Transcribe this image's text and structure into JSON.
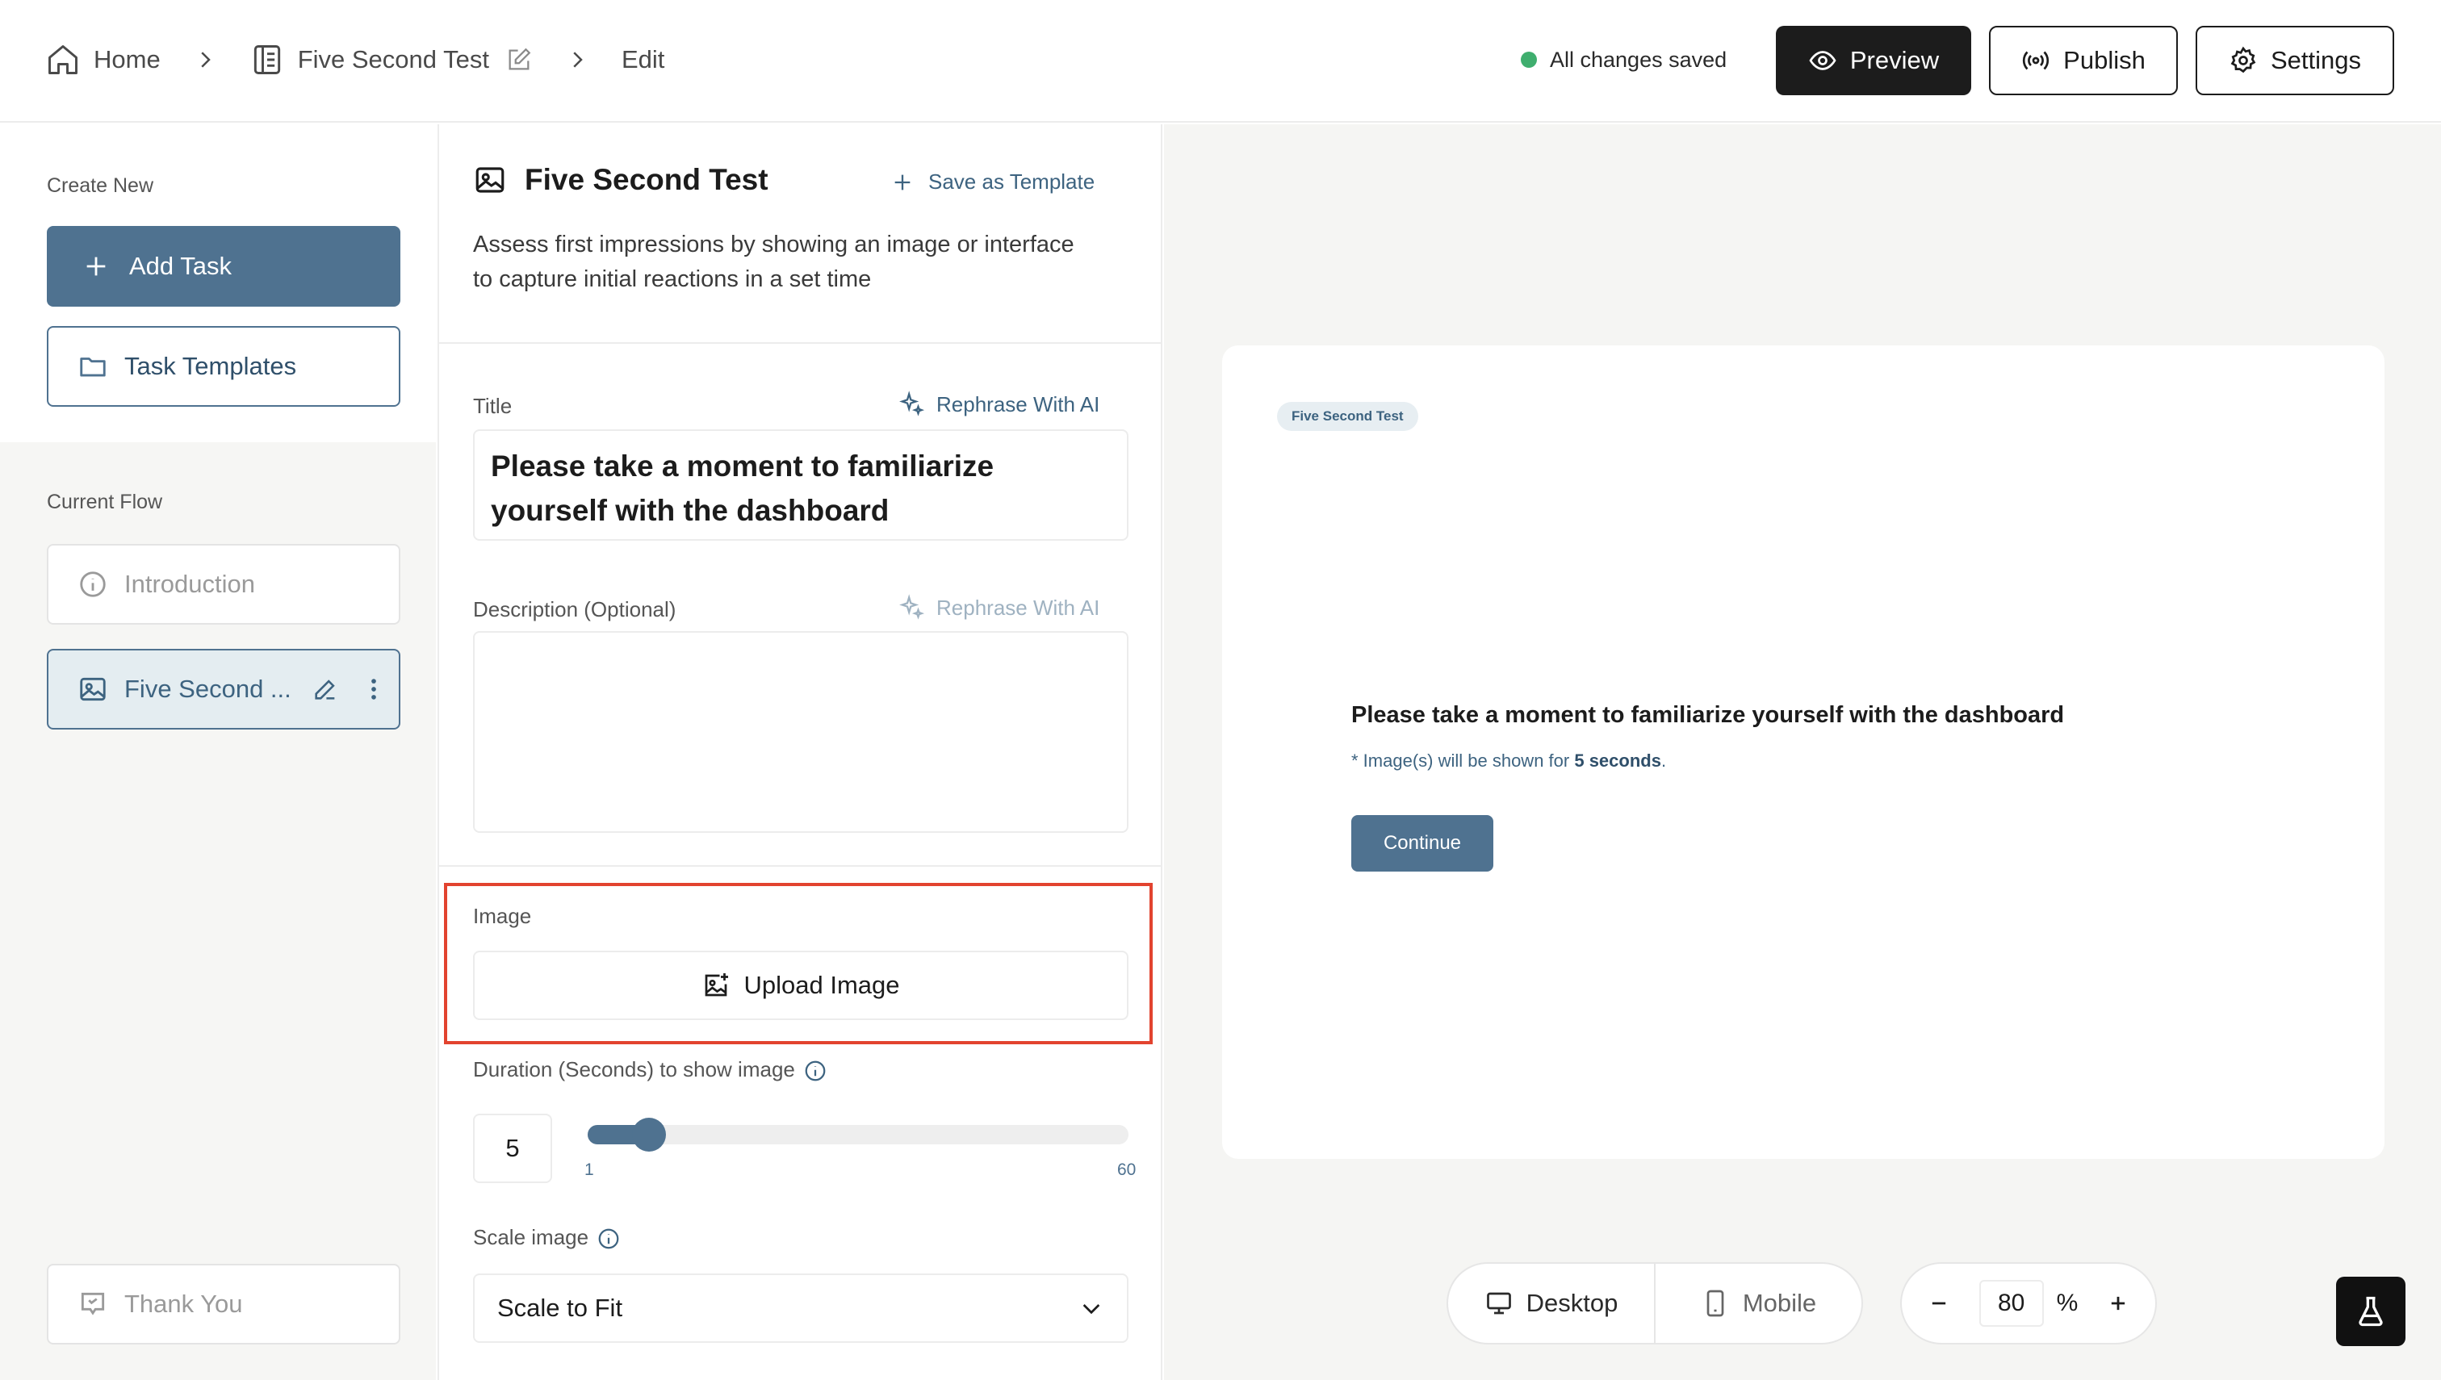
{
  "header": {
    "breadcrumbs": {
      "home": "Home",
      "test_name": "Five Second Test",
      "current": "Edit"
    },
    "save_status": "All changes saved",
    "buttons": {
      "preview": "Preview",
      "publish": "Publish",
      "settings": "Settings"
    }
  },
  "sidebar": {
    "create_new_label": "Create New",
    "add_task": "Add Task",
    "task_templates": "Task Templates",
    "current_flow_label": "Current Flow",
    "flow": {
      "introduction": "Introduction",
      "five_second": "Five Second ...",
      "thank_you": "Thank You"
    }
  },
  "editor": {
    "heading": "Five Second Test",
    "save_template": "Save as Template",
    "description": "Assess first impressions by showing an image or interface to capture initial reactions in a set time",
    "title_label": "Title",
    "rephrase": "Rephrase With AI",
    "title_value": "Please take a moment to familiarize yourself with the dashboard",
    "description_label": "Description (Optional)",
    "description_value": "",
    "image_label": "Image",
    "upload_image": "Upload Image",
    "duration_label": "Duration (Seconds) to show image",
    "duration_value": "5",
    "slider": {
      "min": "1",
      "max": "60",
      "value": 5,
      "min_value": 1,
      "max_value": 60
    },
    "scale_label": "Scale image",
    "scale_value": "Scale to Fit"
  },
  "preview": {
    "tag": "Five Second Test",
    "title": "Please take a moment to familiarize yourself with the dashboard",
    "note_prefix": "* Image(s) will be shown for",
    "note_value": "5 seconds",
    "note_suffix": ".",
    "continue": "Continue",
    "device": {
      "desktop": "Desktop",
      "mobile": "Mobile"
    },
    "zoom": {
      "value": "80",
      "unit": "%"
    }
  },
  "colors": {
    "accent": "#4f7290",
    "highlight": "#e2432f",
    "status_dot": "#3fae6e",
    "dark": "#1c1c1c"
  },
  "icons": [
    "home-icon",
    "document-icon",
    "pencil-icon",
    "chevron-right-icon",
    "eye-icon",
    "broadcast-icon",
    "gear-icon",
    "plus-icon",
    "folder-icon",
    "info-icon",
    "image-icon",
    "more-vertical-icon",
    "message-icon",
    "sparkle-icon",
    "image-plus-icon",
    "chevron-down-icon",
    "monitor-icon",
    "smartphone-icon",
    "minus-icon",
    "flask-icon"
  ]
}
